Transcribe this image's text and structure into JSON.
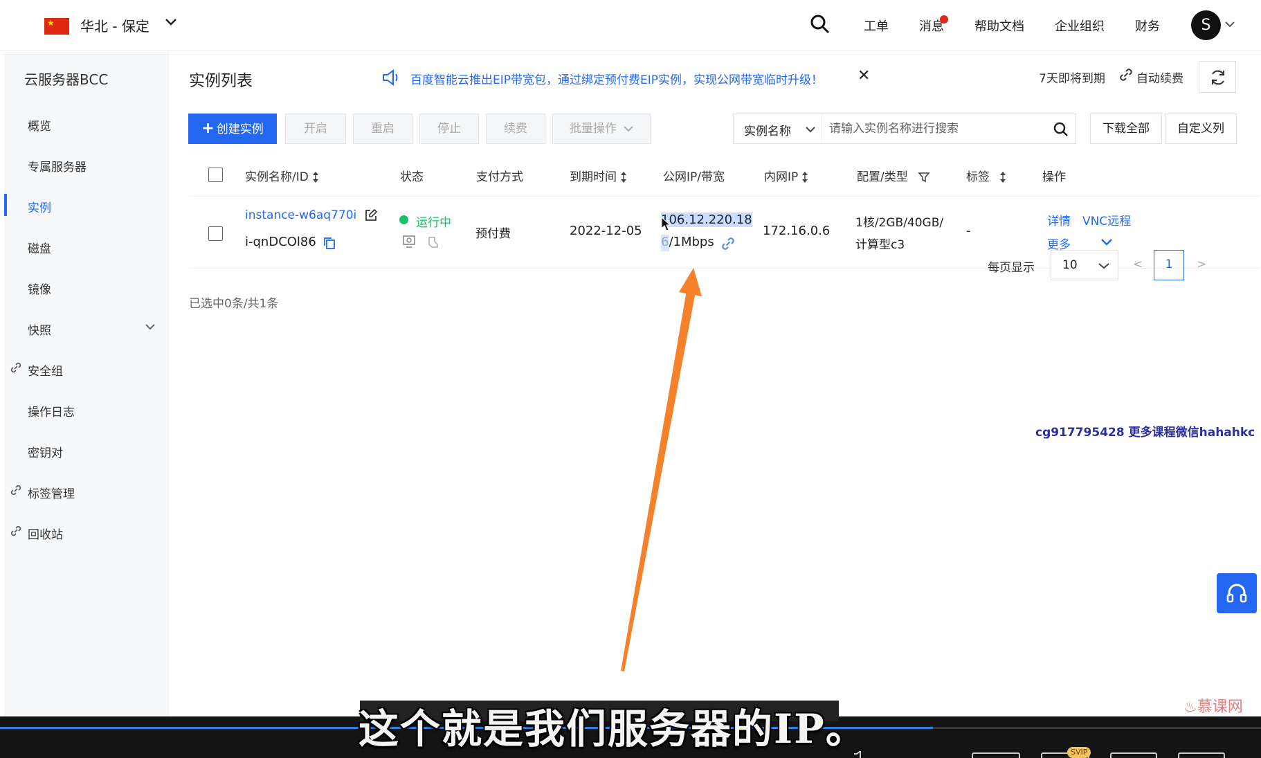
{
  "header": {
    "region": "华北 - 保定",
    "nav": [
      "工单",
      "消息",
      "帮助文档",
      "企业组织",
      "财务"
    ],
    "avatar_letter": "S"
  },
  "sidebar": {
    "title": "云服务器BCC",
    "items": [
      {
        "label": "概览",
        "link": false
      },
      {
        "label": "专属服务器",
        "link": false
      },
      {
        "label": "实例",
        "link": false,
        "active": true
      },
      {
        "label": "磁盘",
        "link": false
      },
      {
        "label": "镜像",
        "link": false
      },
      {
        "label": "快照",
        "link": false,
        "expandable": true
      },
      {
        "label": "安全组",
        "link": true
      },
      {
        "label": "操作日志",
        "link": false
      },
      {
        "label": "密钥对",
        "link": false
      },
      {
        "label": "标签管理",
        "link": true
      },
      {
        "label": "回收站",
        "link": true
      }
    ]
  },
  "main": {
    "title": "实例列表",
    "notice": "百度智能云推出EIP带宽包，通过绑定预付费EIP实例，实现公网带宽临时升级！",
    "expire_text": "7天即将到期",
    "auto_renew": "自动续费",
    "toolbar": {
      "create": "创建实例",
      "start": "开启",
      "restart": "重启",
      "stop": "停止",
      "renew": "续费",
      "batch": "批量操作",
      "search_field": "实例名称",
      "search_placeholder": "请输入实例名称进行搜索",
      "download_all": "下载全部",
      "custom_columns": "自定义列"
    },
    "table": {
      "headers": [
        "实例名称/ID",
        "状态",
        "支付方式",
        "到期时间",
        "公网IP/带宽",
        "内网IP",
        "配置/类型",
        "标签",
        "操作"
      ],
      "rows": [
        {
          "name": "instance-w6aq770i",
          "id": "i-qnDCOl86",
          "status": "运行中",
          "payment": "预付费",
          "expire": "2022-12-05",
          "public_ip_line1": "106.12.220.18",
          "public_ip_line2": "6/1Mbps",
          "private_ip": "172.16.0.6",
          "config_line1": "1核/2GB/40GB/",
          "config_line2": "计算型c3",
          "tag": "-",
          "ops": {
            "detail": "详情",
            "vnc": "VNC远程",
            "more": "更多"
          }
        }
      ]
    },
    "selected_info": "已选中0条/共1条",
    "pager": {
      "label": "每页显示",
      "size": "10",
      "prev": "<",
      "current": "1",
      "next": ">"
    }
  },
  "watermark": "cg917795428 更多课程微信hahahkc",
  "brand_logo": "慕课网",
  "subtitle": "这个就是我们服务器的IP。",
  "video": {
    "badge": "SVIP",
    "progress": 0.74
  },
  "colors": {
    "accent": "#2468f2",
    "running": "#14c469",
    "arrow": "#f5822a"
  }
}
